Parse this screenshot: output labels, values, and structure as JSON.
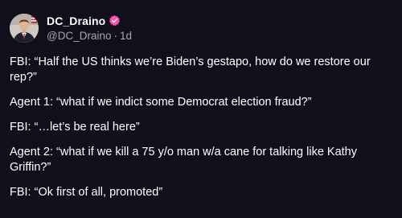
{
  "author": {
    "display_name": "DC_Draino",
    "handle": "@DC_Draino",
    "separator": "·",
    "timestamp": "1d",
    "badge_color": "#ff4fa8",
    "avatar_icon": "profile-photo"
  },
  "post": {
    "paragraphs": [
      "FBI: “Half the US thinks we’re Biden’s gestapo, how do we restore our rep?”",
      "Agent 1: “what if we indict some Democrat election fraud?”",
      "FBI: “…let’s be real here”",
      "Agent 2: “what if we kill a 75 y/o man w/a cane for talking like Kathy Griffin?”",
      "FBI: “Ok first of all, promoted”"
    ]
  },
  "colors": {
    "background": "#120f1c",
    "text": "#ffffff",
    "muted": "#a7a3b3"
  }
}
